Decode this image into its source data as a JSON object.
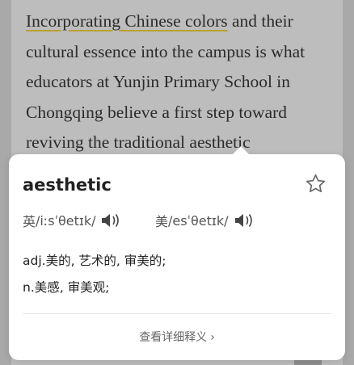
{
  "article": {
    "underlined_phrase": "Incorporating Chinese colors",
    "text_after_phrase": " and their cultural essence into the campus is what educators at Yunjin Primary School in Chongqing believe a first step toward reviving the traditional aesthetic"
  },
  "popup": {
    "word": "aesthetic",
    "uk": {
      "label": "英",
      "ipa": "/iːsˈθetɪk/"
    },
    "us": {
      "label": "美",
      "ipa": "/esˈθetɪk/"
    },
    "definitions": [
      "adj.美的, 艺术的, 审美的;",
      "n.美感, 审美观;"
    ],
    "more_label": "查看详细释义",
    "icons": [
      "star-icon",
      "speaker-icon",
      "chevron-right-icon"
    ]
  },
  "colors": {
    "overlay": "#a9a9a9",
    "underline": "#b8a237",
    "popup_bg": "#ffffff",
    "text": "#222222"
  }
}
